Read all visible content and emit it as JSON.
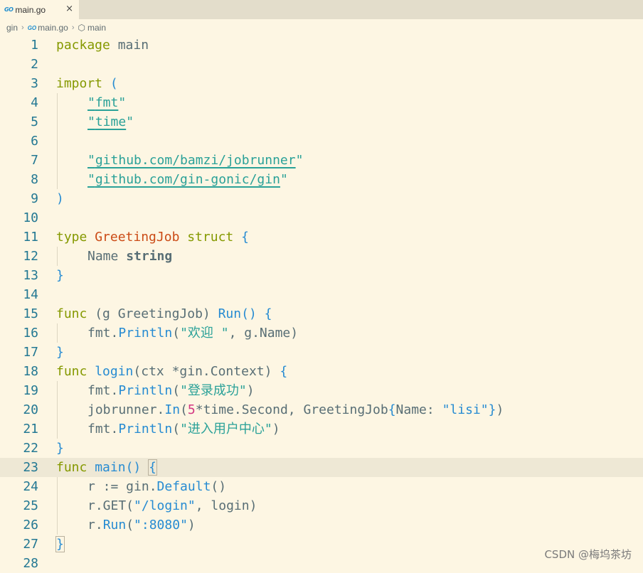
{
  "tab": {
    "icon": "go-file-icon",
    "icon_text": "GO",
    "label": "main.go",
    "close": "×"
  },
  "breadcrumb": {
    "folder": "gin",
    "file": "main.go",
    "symbol": "main",
    "separator": "›"
  },
  "watermark": "CSDN @梅坞茶坊",
  "line_numbers": [
    "1",
    "2",
    "3",
    "4",
    "5",
    "6",
    "7",
    "8",
    "9",
    "10",
    "11",
    "12",
    "13",
    "14",
    "15",
    "16",
    "17",
    "18",
    "19",
    "20",
    "21",
    "22",
    "23",
    "24",
    "25",
    "26",
    "27",
    "28"
  ],
  "code": {
    "l1": {
      "kw": "package",
      "name": " main"
    },
    "l3": {
      "kw": "import",
      "sp": " ",
      "paren": "("
    },
    "l4": {
      "q1": "\"",
      "pkg": "fmt",
      "q2": "\""
    },
    "l5": {
      "q1": "\"",
      "pkg": "time",
      "q2": "\""
    },
    "l7": {
      "q1": "\"",
      "pkg": "github.com/bamzi/jobrunner",
      "q2": "\""
    },
    "l8": {
      "q1": "\"",
      "pkg": "github.com/gin-gonic/gin",
      "q2": "\""
    },
    "l9": {
      "paren": ")"
    },
    "l11": {
      "kw1": "type",
      "name": " GreetingJob",
      "kw2": " struct",
      "sp": " ",
      "brace": "{"
    },
    "l12": {
      "field": "Name ",
      "type": "string"
    },
    "l13": {
      "brace": "}"
    },
    "l15": {
      "kw": "func",
      "a": " (g GreetingJob) ",
      "fn": "Run",
      "b": "()",
      "sp": " ",
      "brace": "{"
    },
    "l16": {
      "a": "fmt.",
      "fn": "Println",
      "b": "(",
      "str": "\"欢迎 \"",
      "c": ", g.Name)"
    },
    "l17": {
      "brace": "}"
    },
    "l18": {
      "kw": "func",
      "sp": " ",
      "fn": "login",
      "a": "(ctx *gin.Context)",
      "sp2": " ",
      "brace": "{"
    },
    "l19": {
      "a": "fmt.",
      "fn": "Println",
      "b": "(",
      "str": "\"登录成功\"",
      "c": ")"
    },
    "l20": {
      "a": "jobrunner.",
      "fn": "In",
      "b": "(",
      "num": "5",
      "c": "*time.Second, GreetingJob",
      "d": "{",
      "e": "Name: ",
      "str": "\"lisi\"",
      "f": "}",
      "g": ")"
    },
    "l21": {
      "a": "fmt.",
      "fn": "Println",
      "b": "(",
      "str": "\"进入用户中心\"",
      "c": ")"
    },
    "l22": {
      "brace": "}"
    },
    "l23": {
      "kw": "func",
      "sp": " ",
      "fn": "main",
      "a": "()",
      "sp2": " ",
      "brace": "{"
    },
    "l24": {
      "a": "r := gin.",
      "fn": "Default",
      "b": "()"
    },
    "l25": {
      "a": "r.GET(",
      "str": "\"/login\"",
      "c": ", login)"
    },
    "l26": {
      "a": "r.",
      "fn": "Run",
      "b": "(",
      "str": "\":8080\"",
      "c": ")"
    },
    "l27": {
      "brace": "}"
    }
  }
}
